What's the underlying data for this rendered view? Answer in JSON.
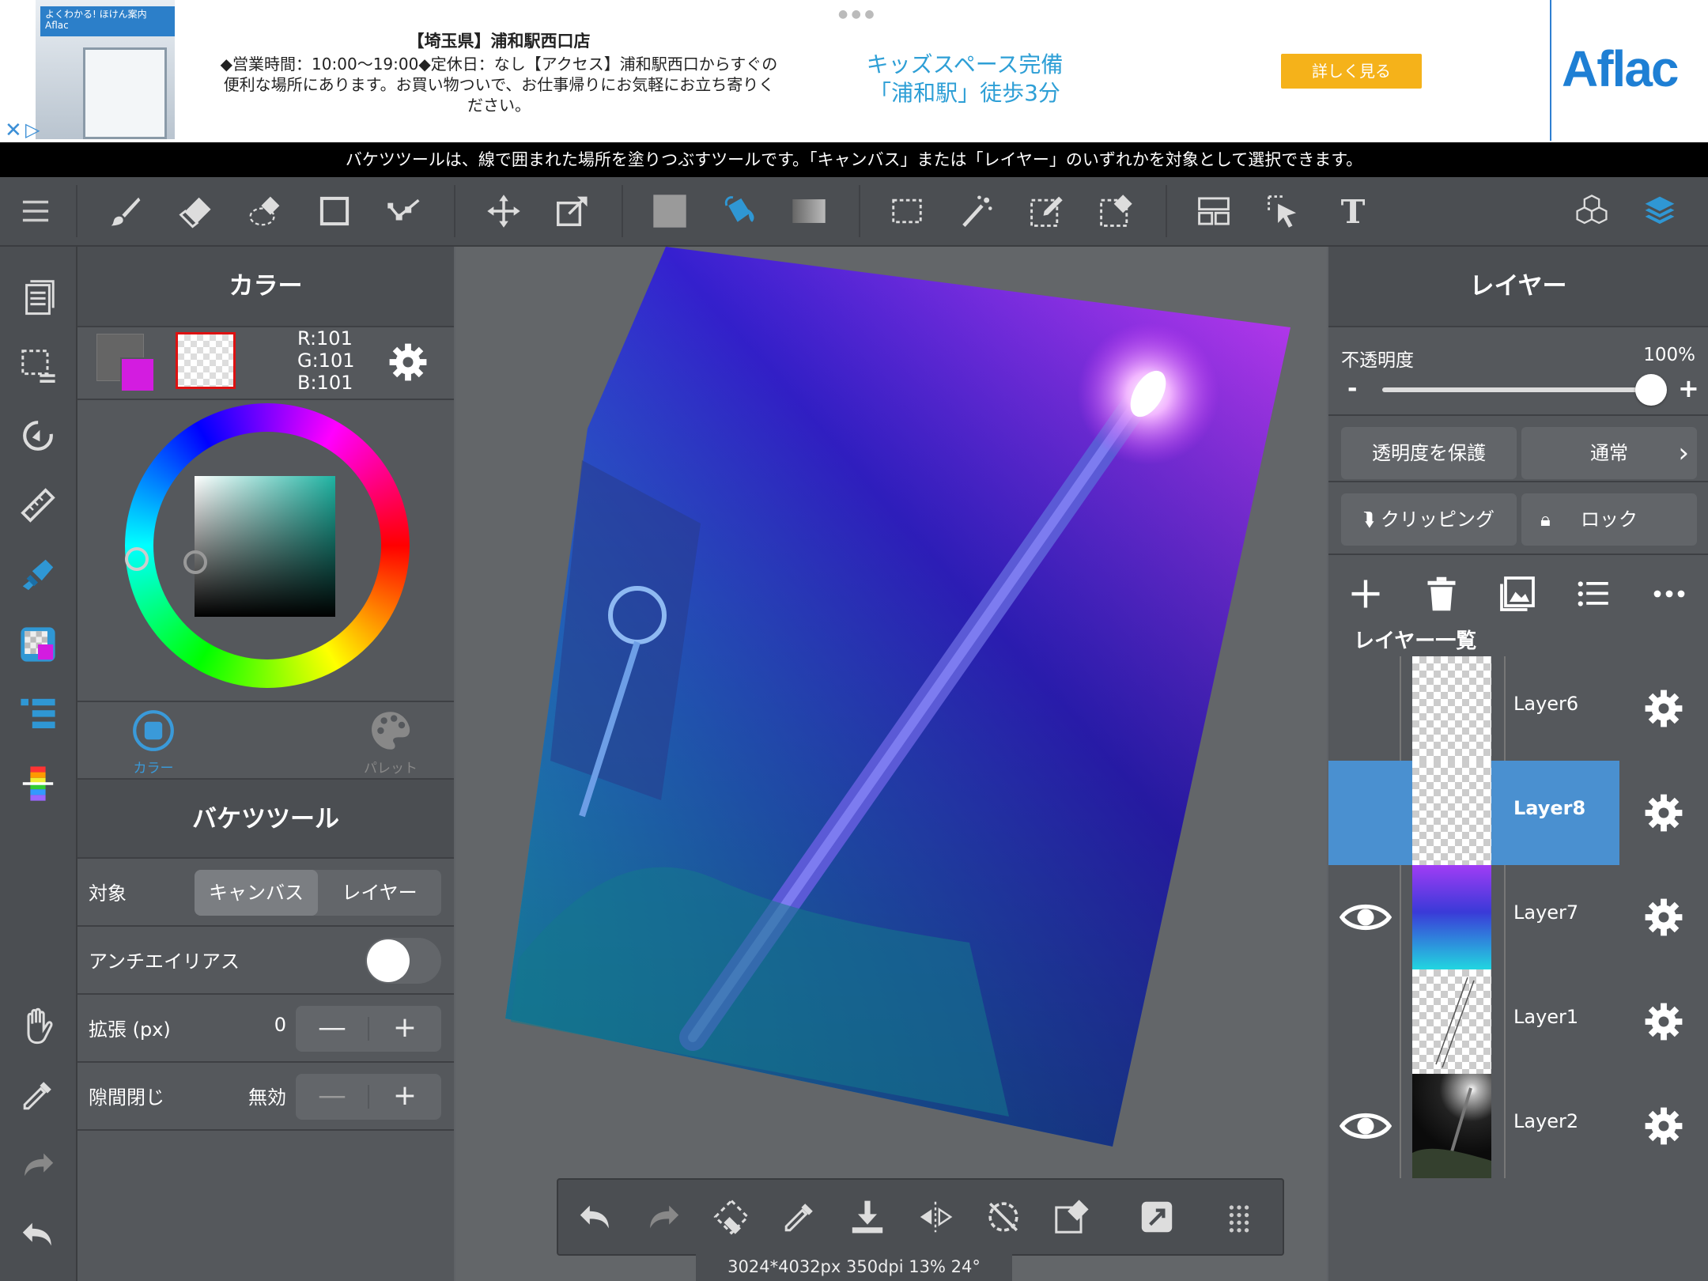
{
  "ad": {
    "photo_sign": "よくわかる! ほけん案内 Aflac",
    "title": "【埼玉県】浦和駅西口店",
    "body": "◆営業時間：10:00〜19:00◆定休日：なし【アクセス】浦和駅西口からすぐの便利な場所にあります。お買い物ついで、お仕事帰りにお気軽にお立ち寄りください。",
    "catch_line1": "キッズスペース完備",
    "catch_line2": "「浦和駅」徒歩3分",
    "button": "詳しく見る",
    "logo": "Aflac"
  },
  "hint": "バケツツールは、線で囲まれた場所を塗りつぶすツールです。「キャンバス」または「レイヤー」のいずれかを対象として選択できます。",
  "color_panel": {
    "title": "カラー",
    "r": "R:101",
    "g": "G:101",
    "b": "B:101",
    "main_color": "#656565",
    "sub_color": "#d31ce0",
    "tabs": [
      "カラー",
      "パレット"
    ]
  },
  "bucket_tool": {
    "title": "バケツツール",
    "target_label": "対象",
    "target_options": [
      "キャンバス",
      "レイヤー"
    ],
    "target_selected": "キャンバス",
    "antialias_label": "アンチエイリアス",
    "antialias_on": false,
    "expand_label": "拡張 (px)",
    "expand_value": "0",
    "gap_label": "隙間閉じ",
    "gap_value": "無効",
    "minus": "—",
    "plus": "+"
  },
  "status": "3024*4032px 350dpi 13% 24°",
  "layer_panel": {
    "title": "レイヤー",
    "opacity_label": "不透明度",
    "opacity_value": "100%",
    "opacity_fraction": 1.0,
    "minus": "-",
    "plus": "+",
    "protect_alpha": "透明度を保護",
    "blend_mode": "通常",
    "clipping": "クリッピング",
    "lock": "ロック",
    "list_label": "レイヤー一覧",
    "layers": [
      {
        "name": "Layer6",
        "visible": false,
        "selected": false
      },
      {
        "name": "Layer8",
        "visible": false,
        "selected": true
      },
      {
        "name": "Layer7",
        "visible": true,
        "selected": false
      },
      {
        "name": "Layer1",
        "visible": false,
        "selected": false
      },
      {
        "name": "Layer2",
        "visible": true,
        "selected": false
      }
    ]
  },
  "colors": {
    "accent": "#3a9ad9",
    "selected_layer": "#4a90d0",
    "panel": "#55585c",
    "toolbar": "#4b4e52"
  }
}
